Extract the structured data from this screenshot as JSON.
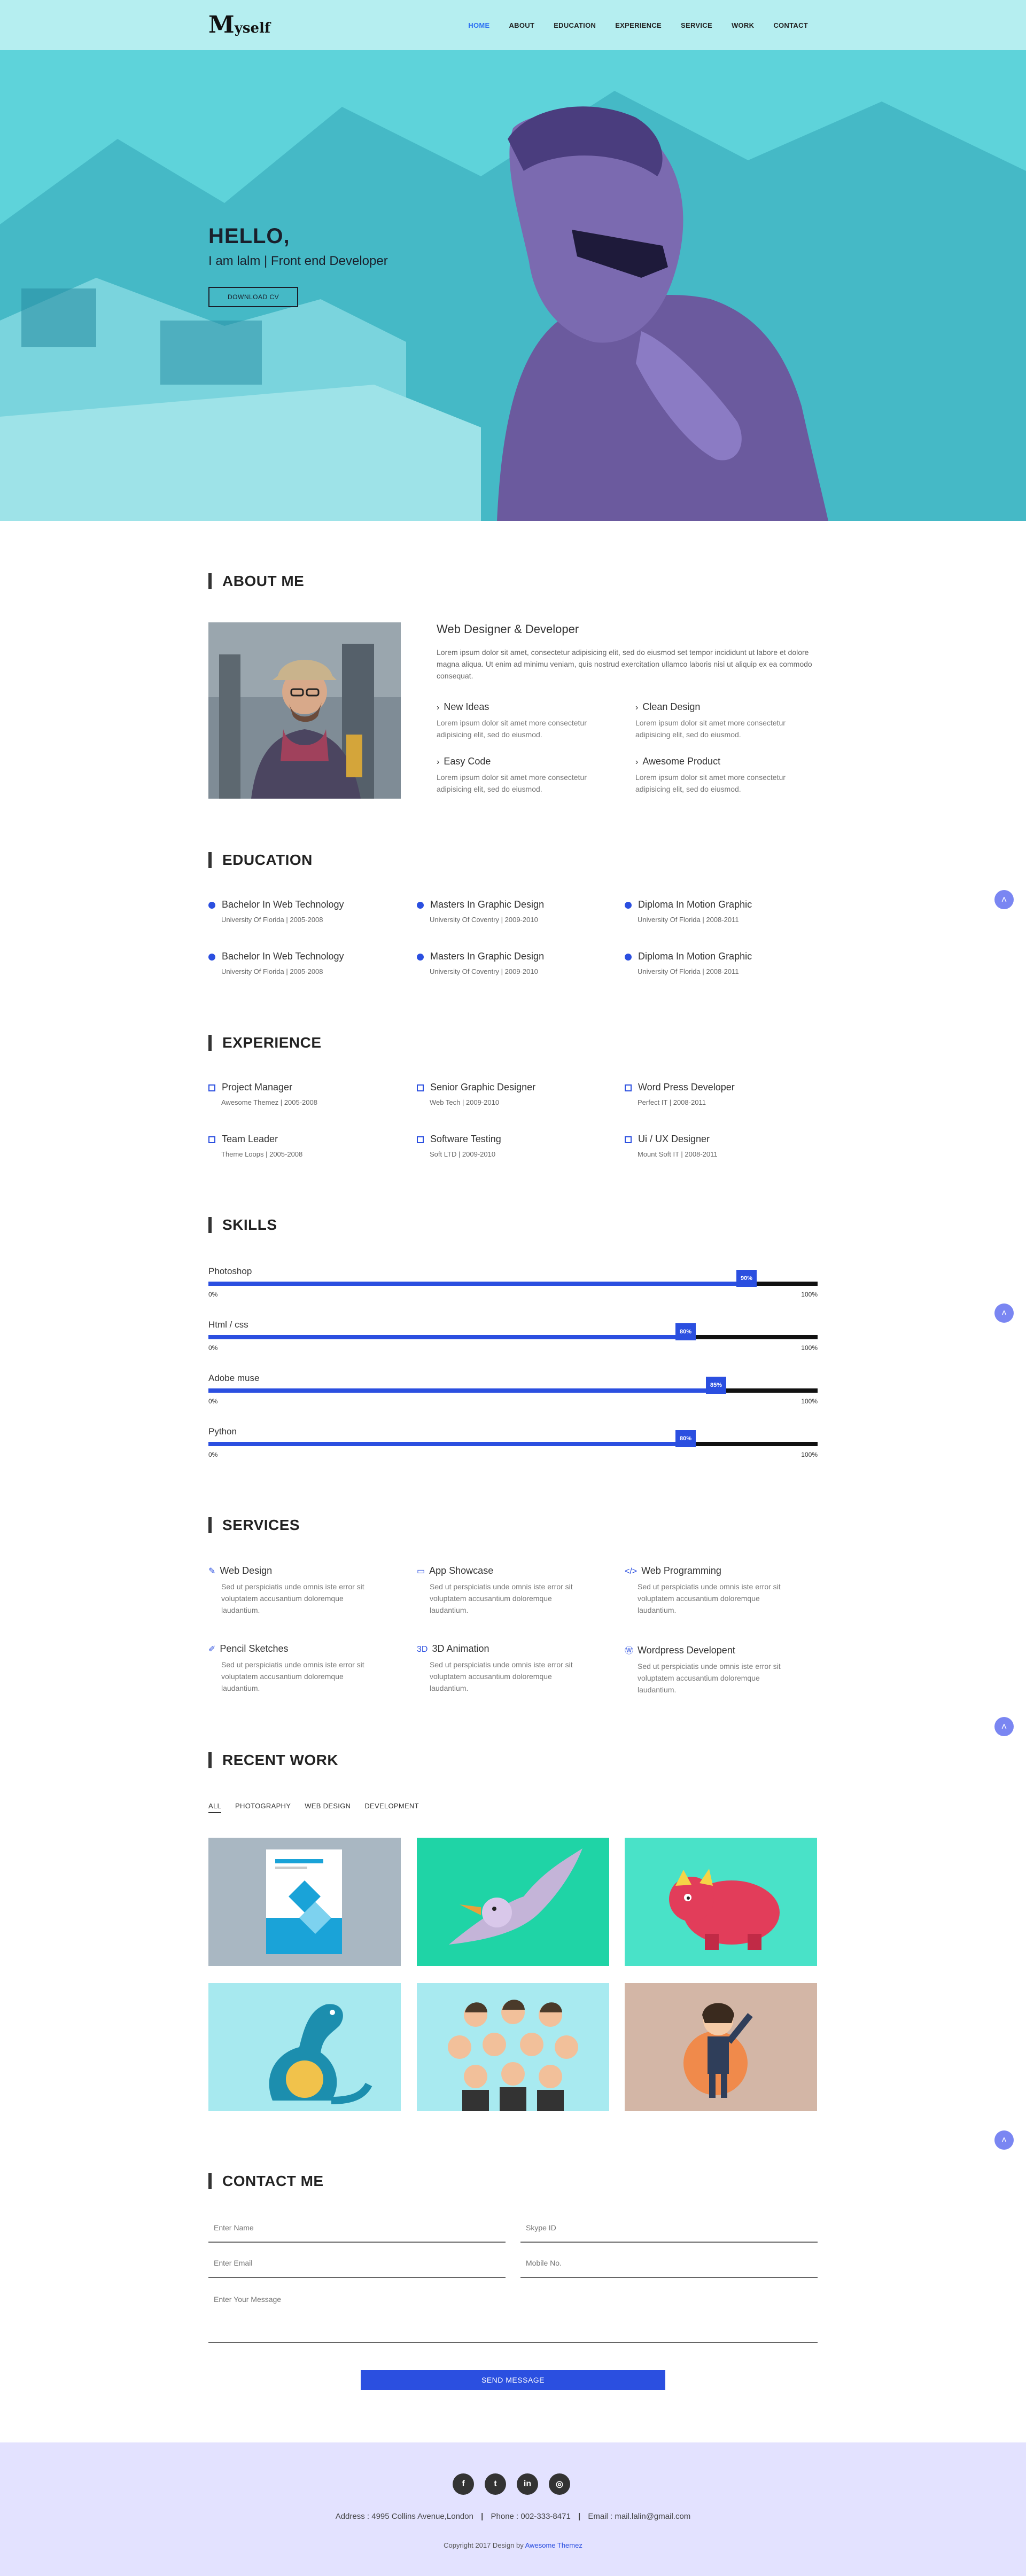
{
  "nav": {
    "logo_initial": "M",
    "logo_rest": "yself",
    "items": [
      "HOME",
      "ABOUT",
      "EDUCATION",
      "EXPERIENCE",
      "SERVICE",
      "WORK",
      "CONTACT"
    ],
    "active": "HOME"
  },
  "hero": {
    "greeting": "HELLO,",
    "tagline": "I am lalm | Front end Developer",
    "button": "DOWNLOAD CV"
  },
  "about": {
    "title": "ABOUT ME",
    "heading": "Web Designer & Developer",
    "paragraph": "Lorem ipsum dolor sit amet, consectetur adipisicing elit, sed do eiusmod set tempor incididunt ut labore et dolore magna aliqua. Ut enim ad minimu veniam, quis nostrud exercitation ullamco laboris nisi ut aliquip ex ea commodo consequat.",
    "features": [
      {
        "title": "New Ideas",
        "text": "Lorem ipsum dolor sit amet more consectetur adipisicing elit, sed do eiusmod."
      },
      {
        "title": "Clean Design",
        "text": "Lorem ipsum dolor sit amet more consectetur adipisicing elit, sed do eiusmod."
      },
      {
        "title": "Easy Code",
        "text": "Lorem ipsum dolor sit amet more consectetur adipisicing elit, sed do eiusmod."
      },
      {
        "title": "Awesome Product",
        "text": "Lorem ipsum dolor sit amet more consectetur adipisicing elit, sed do eiusmod."
      }
    ]
  },
  "education": {
    "title": "EDUCATION",
    "items": [
      {
        "title": "Bachelor In Web Technology",
        "sub": "University Of Florida | 2005-2008"
      },
      {
        "title": "Masters In Graphic Design",
        "sub": "University Of Coventry | 2009-2010"
      },
      {
        "title": "Diploma In Motion Graphic",
        "sub": "University Of Florida | 2008-2011"
      },
      {
        "title": "Bachelor In Web Technology",
        "sub": "University Of Florida | 2005-2008"
      },
      {
        "title": "Masters In Graphic Design",
        "sub": "University Of Coventry | 2009-2010"
      },
      {
        "title": "Diploma In Motion Graphic",
        "sub": "University Of Florida | 2008-2011"
      }
    ]
  },
  "experience": {
    "title": "EXPERIENCE",
    "items": [
      {
        "title": "Project Manager",
        "sub": "Awesome Themez | 2005-2008"
      },
      {
        "title": "Senior Graphic Designer",
        "sub": "Web Tech | 2009-2010"
      },
      {
        "title": "Word Press Developer",
        "sub": "Perfect IT | 2008-2011"
      },
      {
        "title": "Team Leader",
        "sub": "Theme Loops | 2005-2008"
      },
      {
        "title": "Software Testing",
        "sub": "Soft LTD | 2009-2010"
      },
      {
        "title": "Ui / UX Designer",
        "sub": "Mount Soft IT | 2008-2011"
      }
    ]
  },
  "skills": {
    "title": "SKILLS",
    "min_label": "0%",
    "max_label": "100%",
    "items": [
      {
        "name": "Photoshop",
        "percent": 90,
        "label": "90%"
      },
      {
        "name": "Html / css",
        "percent": 80,
        "label": "80%"
      },
      {
        "name": "Adobe muse",
        "percent": 85,
        "label": "85%"
      },
      {
        "name": "Python",
        "percent": 80,
        "label": "80%"
      }
    ]
  },
  "services": {
    "title": "SERVICES",
    "items": [
      {
        "title": "Web Design",
        "icon": "brush-icon",
        "glyph": "✎",
        "text": "Sed ut perspiciatis unde omnis iste error sit voluptatem accusantium doloremque laudantium."
      },
      {
        "title": "App Showcase",
        "icon": "laptop-icon",
        "glyph": "▭",
        "text": "Sed ut perspiciatis unde omnis iste error sit voluptatem accusantium doloremque laudantium."
      },
      {
        "title": "Web Programming",
        "icon": "code-icon",
        "glyph": "</>",
        "text": "Sed ut perspiciatis unde omnis iste error sit voluptatem accusantium doloremque laudantium."
      },
      {
        "title": "Pencil Sketches",
        "icon": "edit-icon",
        "glyph": "✐",
        "text": "Sed ut perspiciatis unde omnis iste error sit voluptatem accusantium doloremque laudantium."
      },
      {
        "title": "3D Animation",
        "icon": "3d-icon",
        "glyph": "3D",
        "text": "Sed ut perspiciatis unde omnis iste error sit voluptatem accusantium doloremque laudantium."
      },
      {
        "title": "Wordpress Developent",
        "icon": "wordpress-icon",
        "glyph": "Ⓦ",
        "text": "Sed ut perspiciatis unde omnis iste error sit voluptatem accusantium doloremque laudantium."
      }
    ]
  },
  "work": {
    "title": "RECENT WORK",
    "filters": [
      "ALL",
      "PHOTOGRAPHY",
      "WEB DESIGN",
      "DEVELOPMENT"
    ],
    "active_filter": "ALL",
    "tiles": [
      {
        "name": "work-item-business-flyer",
        "bg": "#a9b7c2"
      },
      {
        "name": "work-item-pterodactyl",
        "bg": "#1fd4a6"
      },
      {
        "name": "work-item-red-dinosaur",
        "bg": "#49e2c8"
      },
      {
        "name": "work-item-blue-dinosaur",
        "bg": "#a7e9ef"
      },
      {
        "name": "work-item-people-group",
        "bg": "#a8eaf0"
      },
      {
        "name": "work-item-singer-girl",
        "bg": "#d3b6a6"
      }
    ]
  },
  "contact": {
    "title": "CONTACT ME",
    "name_placeholder": "Enter Name",
    "skype_placeholder": "Skype ID",
    "email_placeholder": "Enter Email",
    "mobile_placeholder": "Mobile No.",
    "message_placeholder": "Enter Your Message",
    "send_label": "SEND MESSAGE"
  },
  "footer": {
    "social": [
      {
        "name": "facebook-icon",
        "glyph": "f"
      },
      {
        "name": "twitter-icon",
        "glyph": "t"
      },
      {
        "name": "linkedin-icon",
        "glyph": "in"
      },
      {
        "name": "instagram-icon",
        "glyph": "◎"
      }
    ],
    "address": "Address : 4995 Collins Avenue,London",
    "phone": "Phone : 002-333-8471",
    "email": "Email : mail.lalin@gmail.com",
    "copyright": "Copyright 2017 Design by",
    "credit": "Awesome Themez"
  },
  "colors": {
    "accent": "#2b4fe0",
    "hero": "#5fd6dc",
    "footer": "#e3e2ff",
    "navbar": "#b5eef0"
  }
}
